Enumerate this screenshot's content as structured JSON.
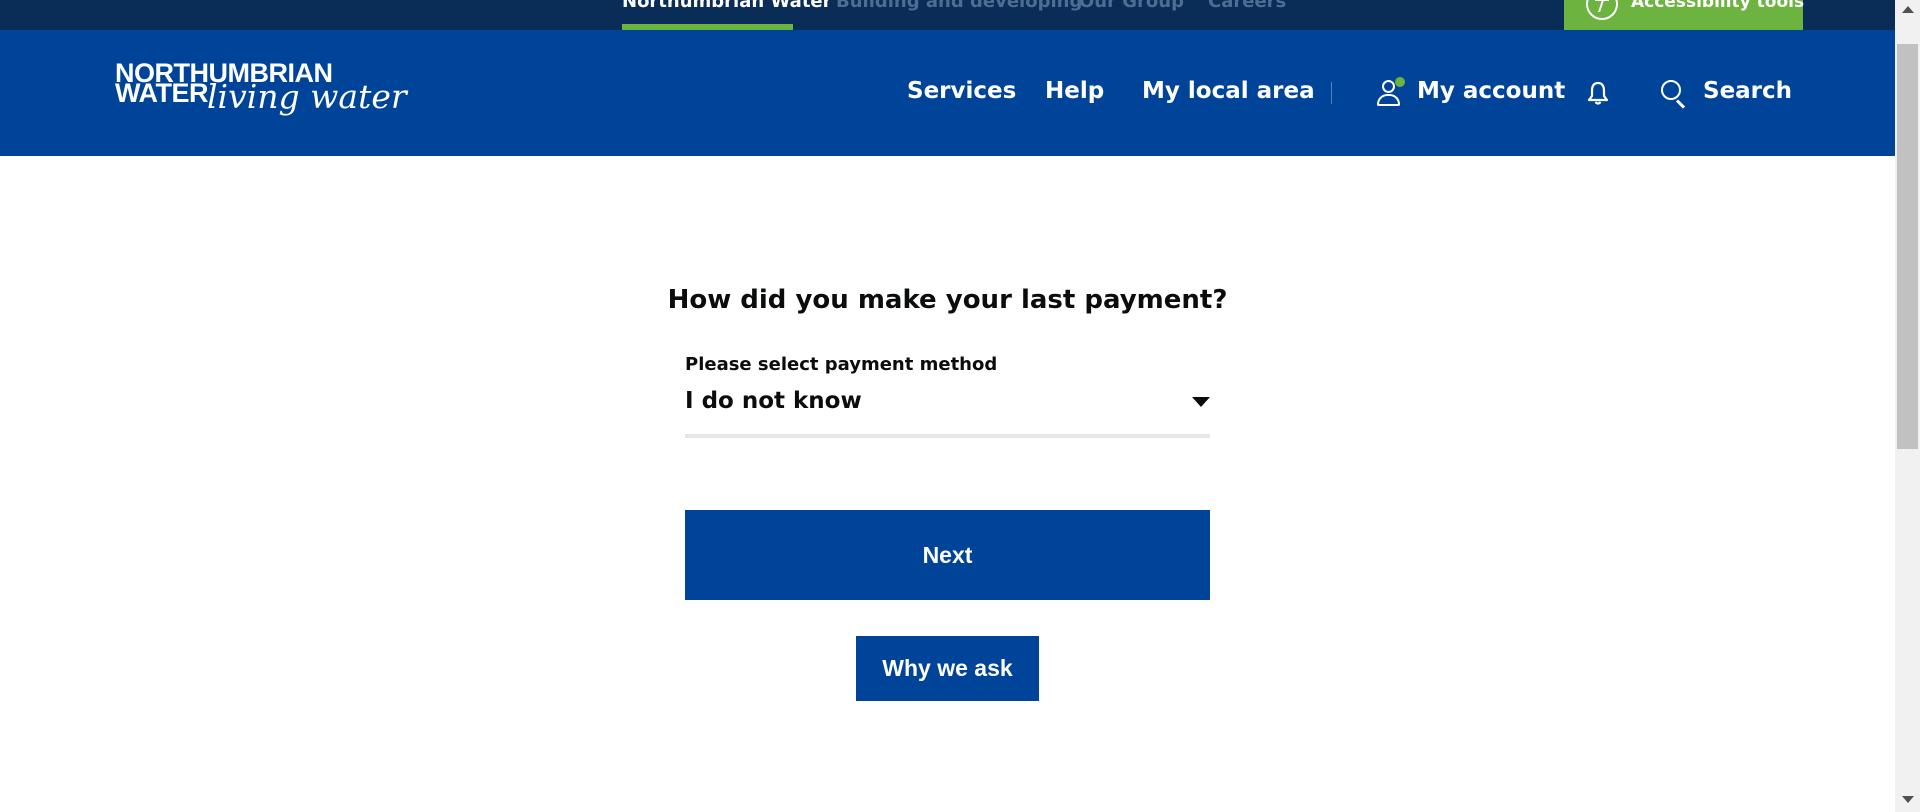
{
  "top_bar": {
    "links": [
      "Northumbrian Water",
      "Building and developing",
      "Our Group",
      "Careers"
    ],
    "active_link": "Northumbrian Water",
    "accessibility_label": "Accessibility tools",
    "accent_color": "#6cb33f"
  },
  "header": {
    "logo": {
      "line1": "NORTHUMBRIAN",
      "line2": "WATER",
      "tagline": "living water"
    },
    "nav": {
      "services": "Services",
      "help": "Help",
      "local_area": "My local area"
    },
    "account_label": "My account",
    "search_label": "Search",
    "icons": [
      "user-icon",
      "bell-icon",
      "search-icon"
    ],
    "brand_color": "#00449a"
  },
  "main": {
    "question": "How did you make your last payment?",
    "select": {
      "label": "Please select payment method",
      "value": "I do not know"
    },
    "next_button": "Next",
    "why_button": "Why we ask"
  }
}
